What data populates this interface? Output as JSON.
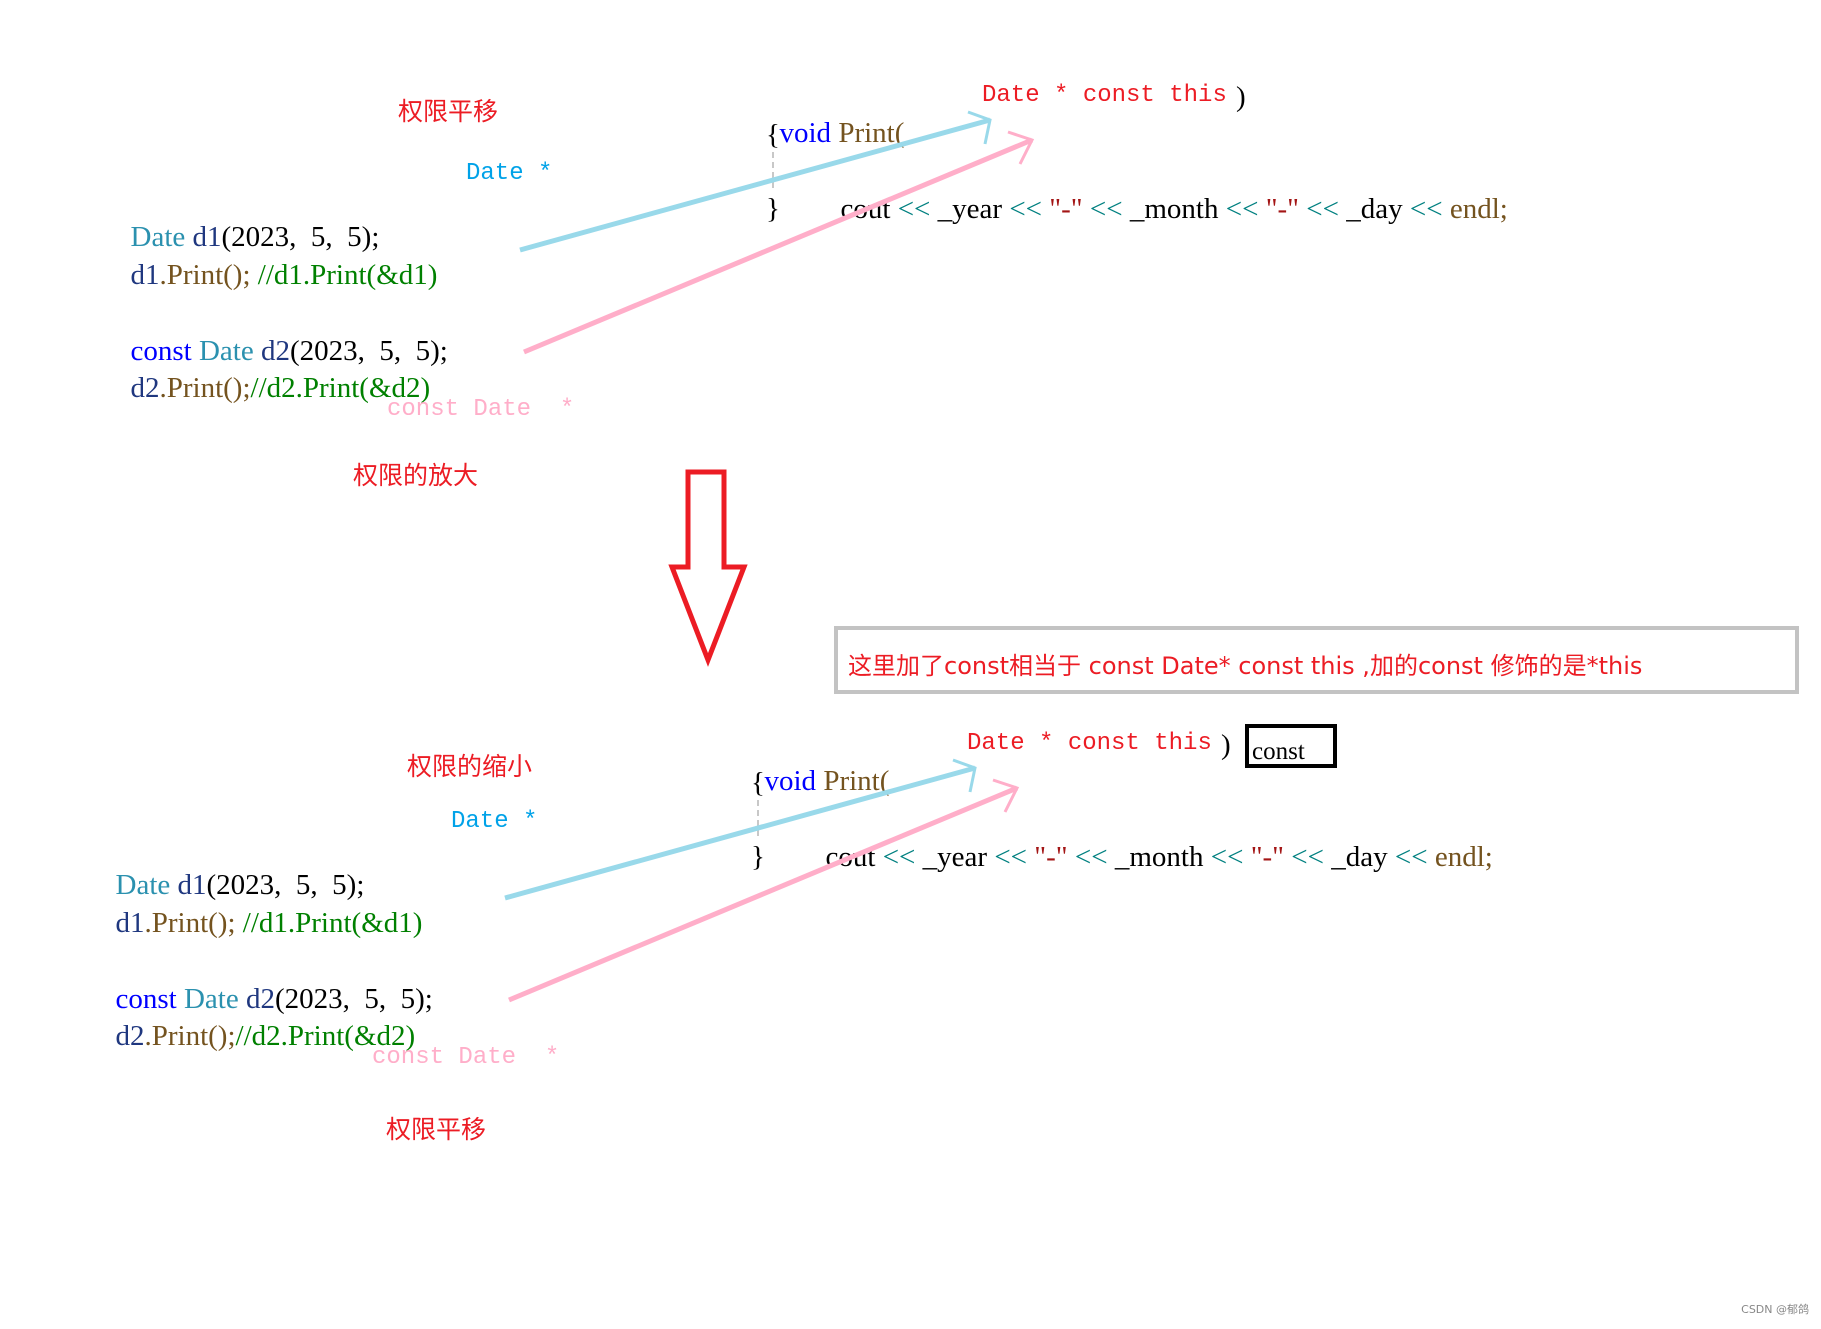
{
  "watermark": "CSDN @郁鸽",
  "arrow_color": "#ec1c24",
  "line_colors": {
    "nonconst": "#99d9ea",
    "const": "#ffaec9"
  },
  "top": {
    "label_top": "权限平移",
    "label_bottom": "权限的放大",
    "hint_nonconst": "Date *",
    "hint_const": "const Date  *",
    "code_left": {
      "line1": {
        "type": "Date",
        "var": "d1",
        "args": "(2023,  5,  5);"
      },
      "line2": {
        "var": "d1",
        "call": ".Print();",
        "comment": " //d1.Print(&d1)"
      },
      "line3": {
        "kw": "const",
        "type": "Date",
        "var": "d2",
        "args": "(2023,  5,  5);"
      },
      "line4": {
        "var": "d2",
        "call": ".Print();",
        "comment": "//d2.Print(&d2)"
      }
    },
    "func": {
      "void": "void",
      "name": "Print(",
      "param": "Date * const this",
      "close": ")",
      "open_brace": "{",
      "close_brace": "}",
      "body": {
        "cout": "cout",
        "op": "<<",
        "year": "_year",
        "dash": "\"-\"",
        "month": "_month",
        "day": "_day",
        "endl": "endl;"
      }
    }
  },
  "note": "这里加了const相当于 const Date* const this ,加的const 修饰的是*this",
  "bottom": {
    "label_top": "权限的缩小",
    "label_bottom": "权限平移",
    "hint_nonconst": "Date *",
    "hint_const": "const Date  *",
    "code_left": {
      "line1": {
        "type": "Date",
        "var": "d1",
        "args": "(2023,  5,  5);"
      },
      "line2": {
        "var": "d1",
        "call": ".Print();",
        "comment": " //d1.Print(&d1)"
      },
      "line3": {
        "kw": "const",
        "type": "Date",
        "var": "d2",
        "args": "(2023,  5,  5);"
      },
      "line4": {
        "var": "d2",
        "call": ".Print();",
        "comment": "//d2.Print(&d2)"
      }
    },
    "func": {
      "void": "void",
      "name": "Print(",
      "param": "Date * const this",
      "close": ")",
      "const_suffix": "const",
      "open_brace": "{",
      "close_brace": "}",
      "body": {
        "cout": "cout",
        "op": "<<",
        "year": "_year",
        "dash": "\"-\"",
        "month": "_month",
        "day": "_day",
        "endl": "endl;"
      }
    }
  }
}
